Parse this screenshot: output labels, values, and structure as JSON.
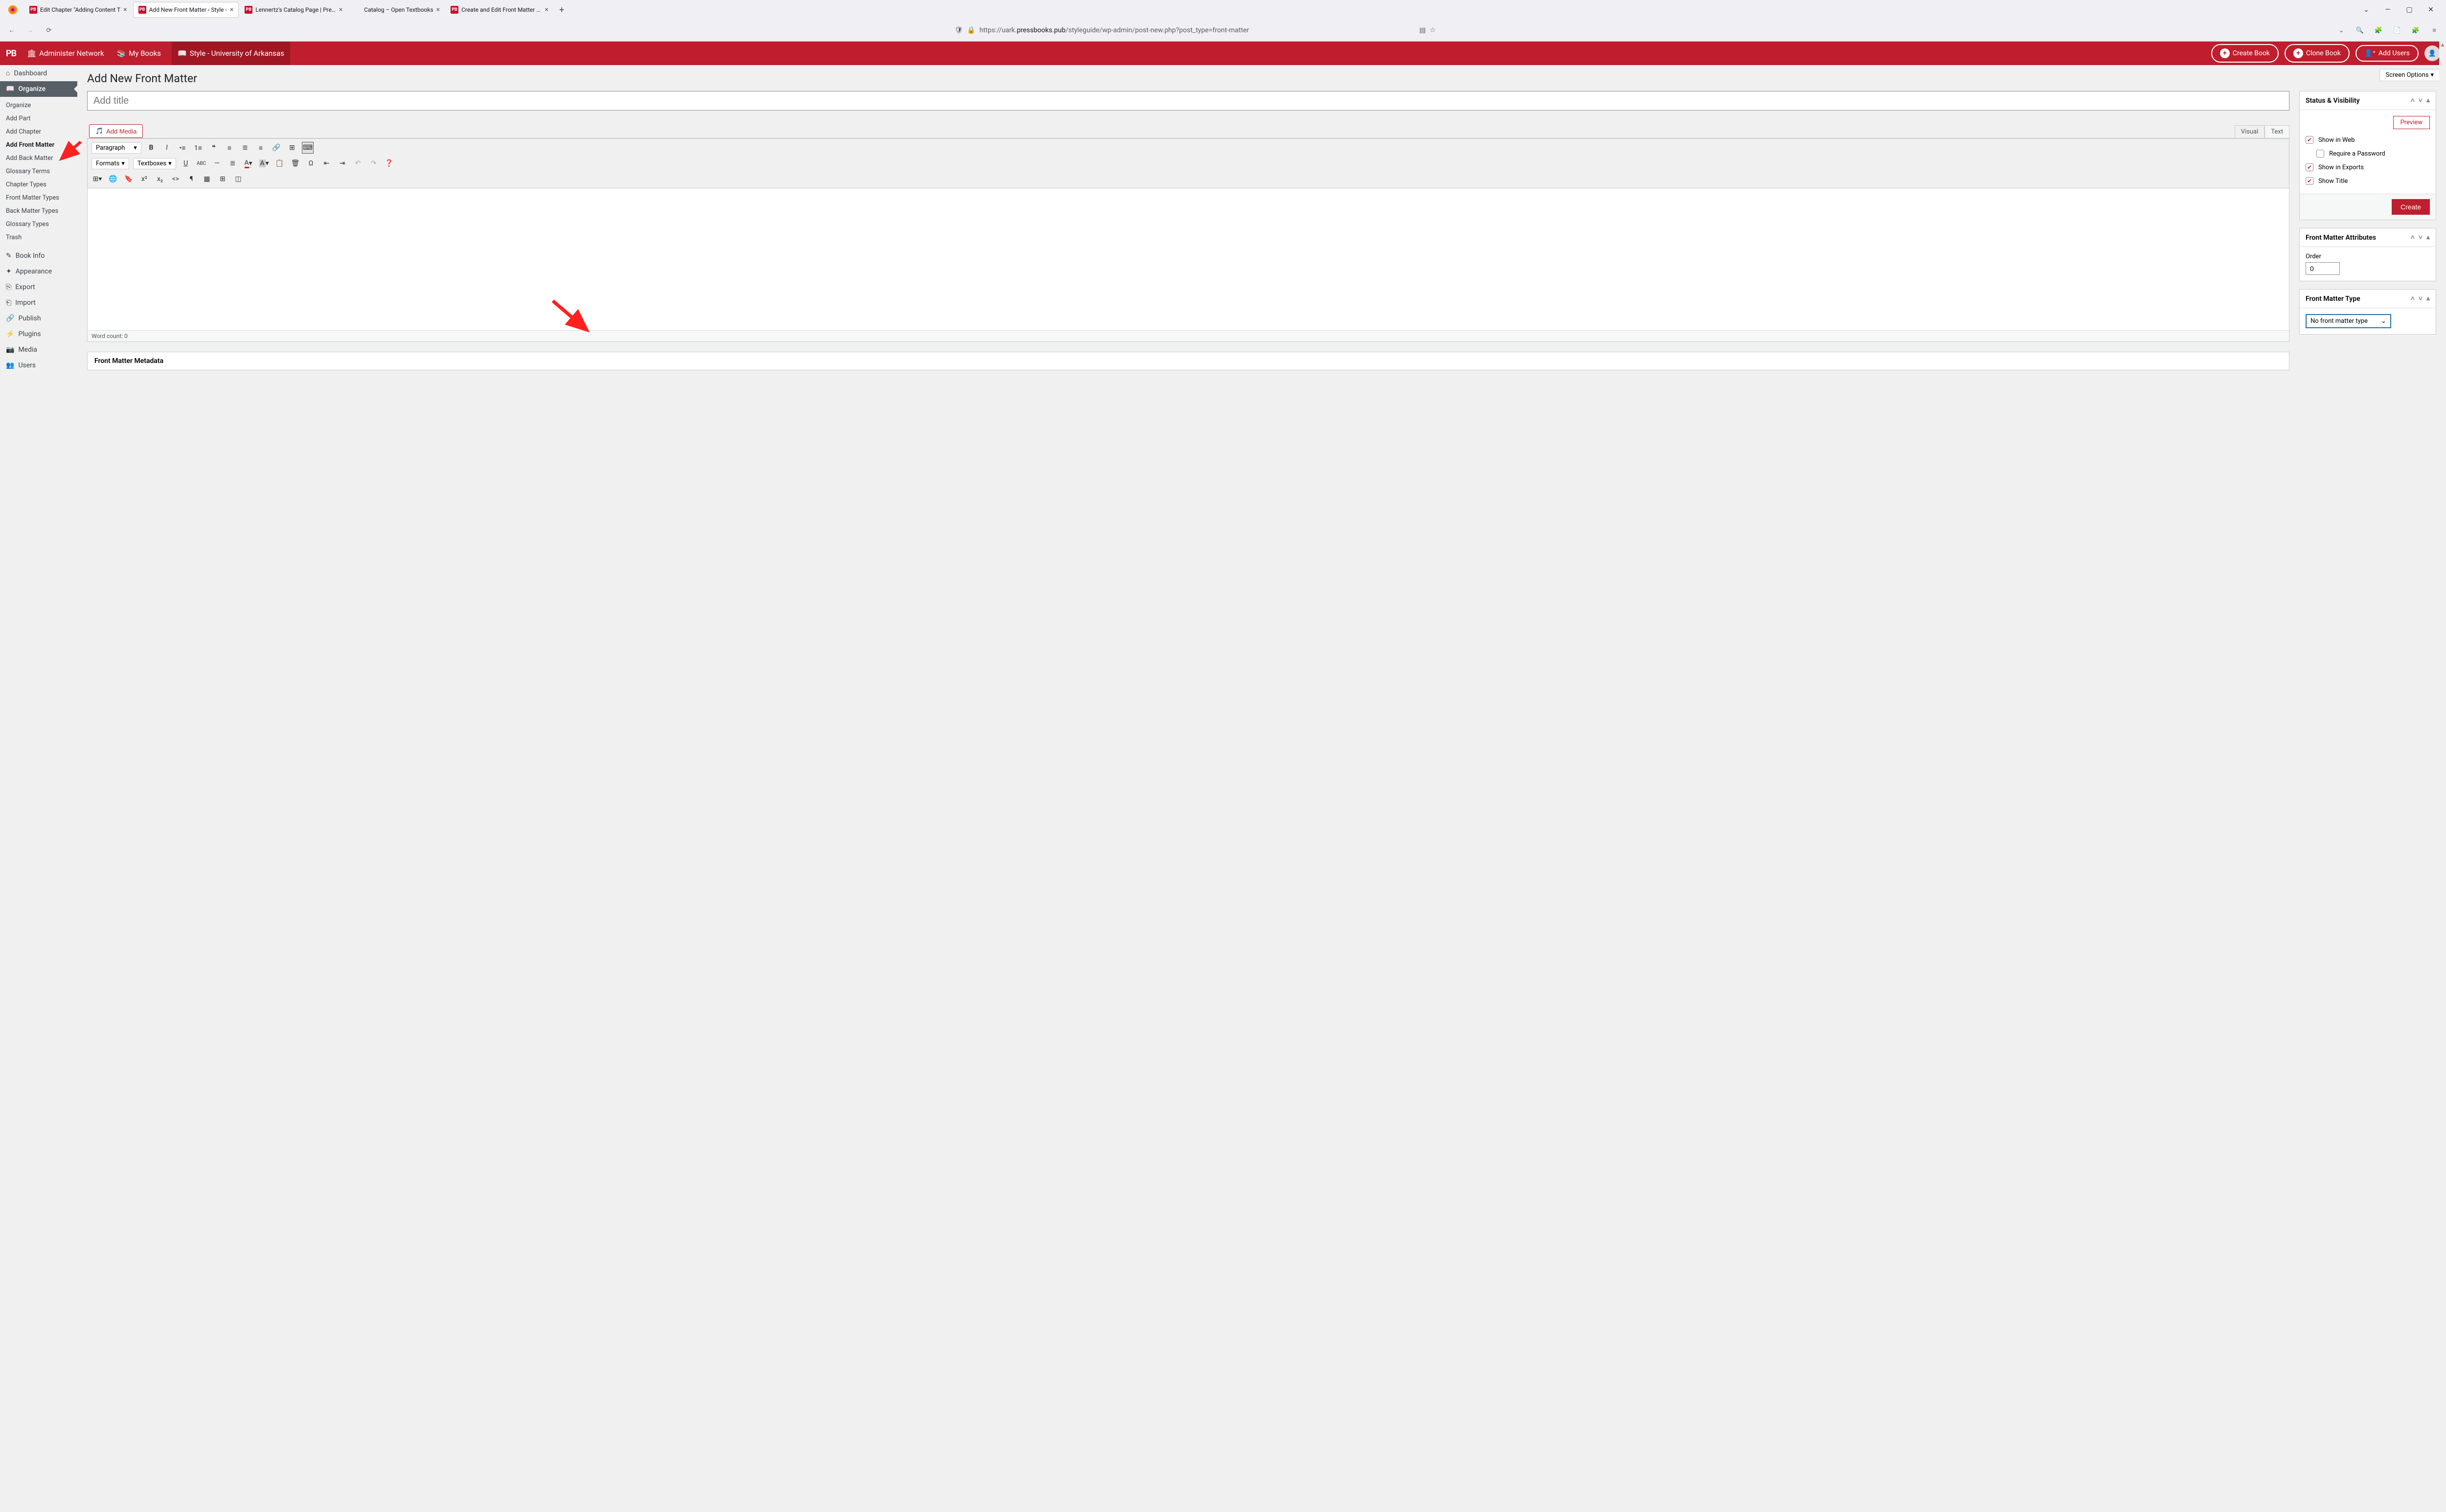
{
  "tabs": [
    {
      "label": "Edit Chapter \"Adding Content T",
      "fav": "PB"
    },
    {
      "label": "Add New Front Matter ‹ Style -",
      "fav": "PB",
      "active": true
    },
    {
      "label": "Lennertz's Catalog Page | Pressb",
      "fav": "PB"
    },
    {
      "label": "Catalog – Open Textbooks",
      "fav": ""
    },
    {
      "label": "Create and Edit Front Matter – P",
      "fav": "PB"
    }
  ],
  "url": {
    "prefix": "https://uark.",
    "domain": "pressbooks.pub",
    "suffix": "/styleguide/wp-admin/post-new.php?post_type=front-matter"
  },
  "pb": {
    "admin": "Administer Network",
    "books": "My Books",
    "current": "Style - University of Arkansas",
    "create_book": "Create Book",
    "clone_book": "Clone Book",
    "add_users": "Add Users"
  },
  "sidebar": {
    "dashboard": "Dashboard",
    "organize": "Organize",
    "subs": [
      "Organize",
      "Add Part",
      "Add Chapter",
      "Add Front Matter",
      "Add Back Matter",
      "Glossary Terms",
      "Chapter Types",
      "Front Matter Types",
      "Back Matter Types",
      "Glossary Types",
      "Trash"
    ],
    "current_sub": "Add Front Matter",
    "book_info": "Book Info",
    "appearance": "Appearance",
    "export": "Export",
    "import": "Import",
    "publish": "Publish",
    "plugins": "Plugins",
    "media": "Media",
    "users": "Users"
  },
  "page": {
    "title": "Add New Front Matter",
    "screen_options": "Screen Options",
    "title_placeholder": "Add title",
    "add_media": "Add Media",
    "visual": "Visual",
    "text": "Text",
    "paragraph": "Paragraph",
    "formats": "Formats",
    "textboxes": "Textboxes",
    "word_count": "Word count: 0",
    "metadata": "Front Matter Metadata"
  },
  "panels": {
    "status": {
      "title": "Status & Visibility",
      "preview": "Preview",
      "show_web": "Show in Web",
      "req_pw": "Require a Password",
      "show_exports": "Show in Exports",
      "show_title": "Show Title",
      "create": "Create"
    },
    "attrs": {
      "title": "Front Matter Attributes",
      "order": "Order",
      "order_val": "0"
    },
    "type": {
      "title": "Front Matter Type",
      "selected": "No front matter type"
    }
  }
}
